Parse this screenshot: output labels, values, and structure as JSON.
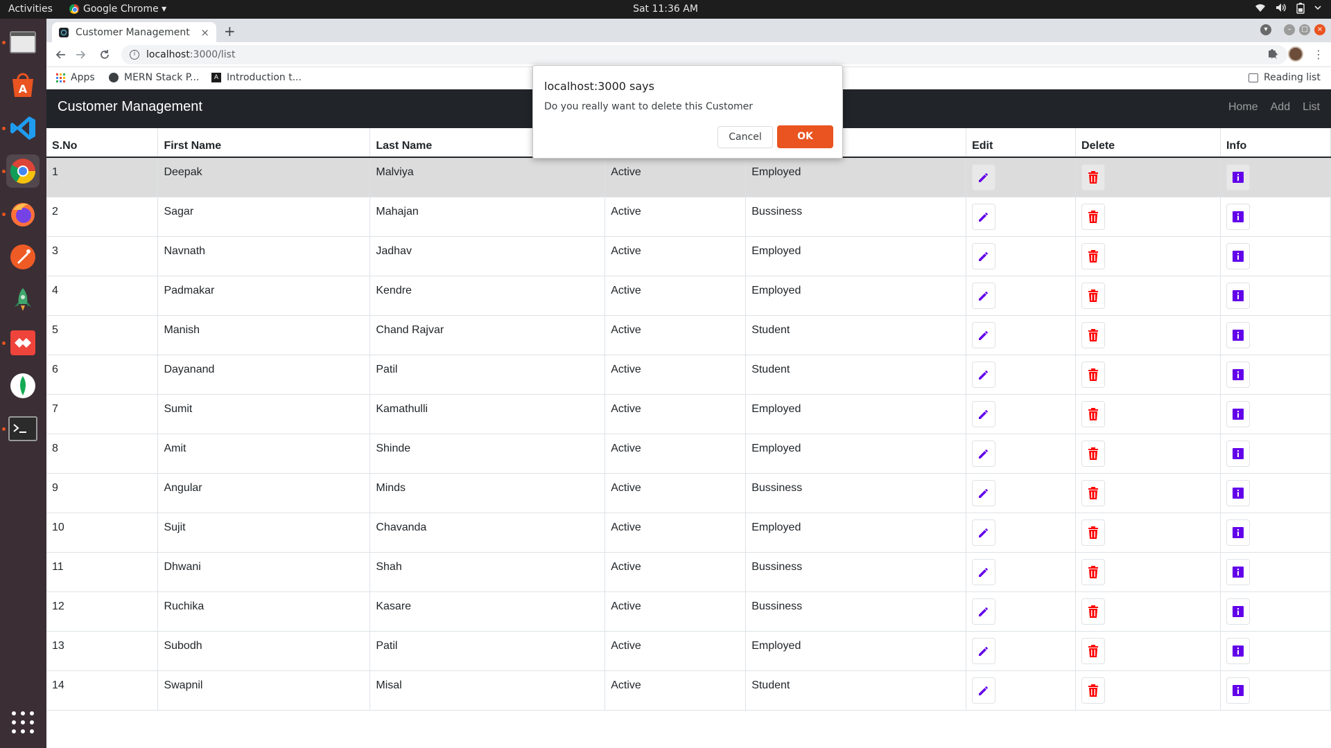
{
  "topbar": {
    "activities": "Activities",
    "app_name": "Google Chrome ▾",
    "clock": "Sat 11:36 AM",
    "tray": [
      "wifi-icon",
      "volume-icon",
      "battery-icon",
      "power-menu-icon"
    ]
  },
  "dock": {
    "items": [
      "file-manager-icon",
      "software-center-icon",
      "vscode-icon",
      "chrome-icon",
      "firefox-icon",
      "postman-icon",
      "rocket-icon",
      "anydesk-icon",
      "mongodb-compass-icon",
      "terminal-icon"
    ],
    "show_apps": "show-apps-icon"
  },
  "browser": {
    "tab_title": "Customer Management",
    "tab_close": "×",
    "new_tab": "+",
    "url_host": "localhost",
    "url_path": ":3000/list",
    "bookmarks": [
      "Apps",
      "MERN Stack P...",
      "Introduction t..."
    ],
    "reading_list": "Reading list"
  },
  "navbar": {
    "brand": "Customer Management",
    "links": [
      "Home",
      "Add",
      "List"
    ]
  },
  "table": {
    "columns": [
      "S.No",
      "First Name",
      "Last Name",
      "",
      "",
      "Edit",
      "Delete",
      "Info"
    ],
    "rows": [
      [
        "1",
        "Deepak",
        "Malviya",
        "Active",
        "Employed"
      ],
      [
        "2",
        "Sagar",
        "Mahajan",
        "Active",
        "Bussiness"
      ],
      [
        "3",
        "Navnath",
        "Jadhav",
        "Active",
        "Employed"
      ],
      [
        "4",
        "Padmakar",
        "Kendre",
        "Active",
        "Employed"
      ],
      [
        "5",
        "Manish",
        "Chand Rajvar",
        "Active",
        "Student"
      ],
      [
        "6",
        "Dayanand",
        "Patil",
        "Active",
        "Student"
      ],
      [
        "7",
        "Sumit",
        "Kamathulli",
        "Active",
        "Employed"
      ],
      [
        "8",
        "Amit",
        "Shinde",
        "Active",
        "Employed"
      ],
      [
        "9",
        "Angular",
        "Minds",
        "Active",
        "Bussiness"
      ],
      [
        "10",
        "Sujit",
        "Chavanda",
        "Active",
        "Employed"
      ],
      [
        "11",
        "Dhwani",
        "Shah",
        "Active",
        "Bussiness"
      ],
      [
        "12",
        "Ruchika",
        "Kasare",
        "Active",
        "Bussiness"
      ],
      [
        "13",
        "Subodh",
        "Patil",
        "Active",
        "Employed"
      ],
      [
        "14",
        "Swapnil",
        "Misal",
        "Active",
        "Student"
      ]
    ],
    "highlighted_row": 1,
    "edit_icon_color": "#6200ea",
    "delete_icon_color": "#ff0000",
    "info_icon_color": "#6200ea"
  },
  "dialog": {
    "title": "localhost:3000 says",
    "message": "Do you really want to delete this Customer",
    "cancel": "Cancel",
    "ok": "OK",
    "ok_color": "#e95420"
  }
}
